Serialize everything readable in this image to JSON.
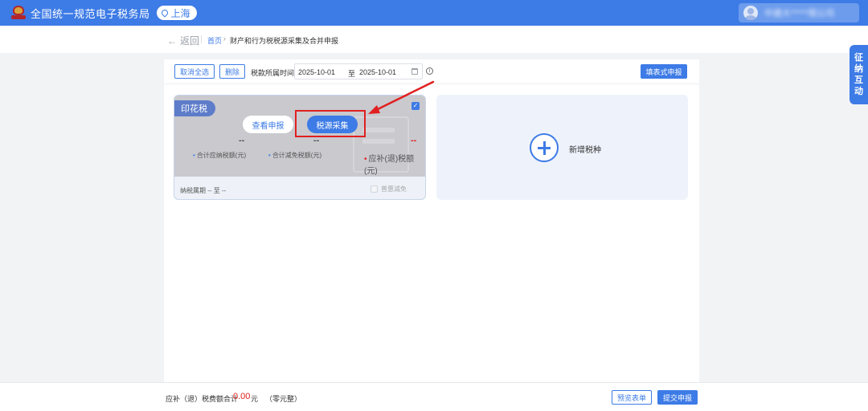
{
  "header": {
    "site_title": "全国统一规范电子税务局",
    "region": "上海",
    "user_name": "中建大*****限公司"
  },
  "breadcrumb": {
    "back_label": "返回",
    "home": "首页",
    "separator": "›",
    "current": "财产和行为税税源采集及合并申报"
  },
  "toolbar": {
    "cancel_all_label": "取消全选",
    "delete_label": "删除",
    "period_label": "税款所属时间",
    "date_from": "2025-10-01",
    "date_to_word": "至",
    "date_to": "2025-10-01",
    "info_icon": "i",
    "form_declare_label": "填表式申报"
  },
  "tax_card": {
    "tag": "印花税",
    "checked": true,
    "check_mark": "✓",
    "view_button": "查看申报",
    "collect_button": "税源采集",
    "stats": [
      {
        "value": "--",
        "label": "合计应纳税额(元)",
        "dot": "•"
      },
      {
        "value": "--",
        "label": "合计减免税额(元)",
        "dot": "•"
      },
      {
        "value": "--",
        "label": "应补(退)税额(元)",
        "dot": "•"
      }
    ],
    "period": "纳税属期 -- 至 --",
    "relief_label": "普惠减免"
  },
  "add_card": {
    "label": "新增税种"
  },
  "side_tab": {
    "chars": [
      "征",
      "纳",
      "互",
      "动"
    ]
  },
  "footer": {
    "sum_label": "应补（退）税费额合计",
    "sum_value": "0.00",
    "sum_unit": "元",
    "sum_words": "（零元整）",
    "preview_label": "预览表单",
    "submit_label": "提交申报"
  },
  "colors": {
    "brand_blue": "#3d7be6",
    "highlight_red": "#e02020",
    "card_overlay_gray": "#c9c9ce",
    "add_card_bg": "#eef3fb"
  },
  "icons": {
    "emblem": "national-emblem-icon",
    "pin": "location-pin-icon",
    "avatar": "user-avatar-icon",
    "calendar": "calendar-icon",
    "info": "info-icon",
    "plus": "plus-circle-icon",
    "back": "back-arrow-icon"
  }
}
